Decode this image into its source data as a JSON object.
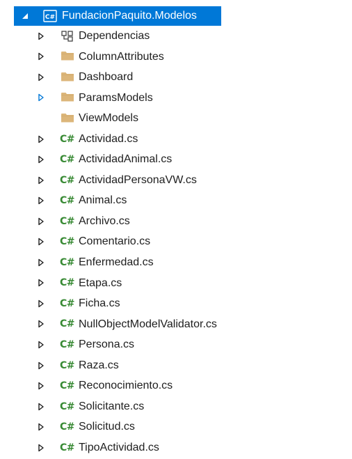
{
  "project": {
    "name": "FundacionPaquito.Modelos",
    "icon": "csharp-project-icon",
    "expanded": true
  },
  "items": [
    {
      "label": "Dependencias",
      "icon": "dependencies-icon",
      "expander": "collapsed"
    },
    {
      "label": "ColumnAttributes",
      "icon": "folder-icon",
      "expander": "collapsed"
    },
    {
      "label": "Dashboard",
      "icon": "folder-icon",
      "expander": "collapsed"
    },
    {
      "label": "ParamsModels",
      "icon": "folder-icon",
      "expander": "collapsed-highlight"
    },
    {
      "label": "ViewModels",
      "icon": "folder-icon",
      "expander": "none"
    },
    {
      "label": "Actividad.cs",
      "icon": "csharp-file-icon",
      "expander": "collapsed"
    },
    {
      "label": "ActividadAnimal.cs",
      "icon": "csharp-file-icon",
      "expander": "collapsed"
    },
    {
      "label": "ActividadPersonaVW.cs",
      "icon": "csharp-file-icon",
      "expander": "collapsed"
    },
    {
      "label": "Animal.cs",
      "icon": "csharp-file-icon",
      "expander": "collapsed"
    },
    {
      "label": "Archivo.cs",
      "icon": "csharp-file-icon",
      "expander": "collapsed"
    },
    {
      "label": "Comentario.cs",
      "icon": "csharp-file-icon",
      "expander": "collapsed"
    },
    {
      "label": "Enfermedad.cs",
      "icon": "csharp-file-icon",
      "expander": "collapsed"
    },
    {
      "label": "Etapa.cs",
      "icon": "csharp-file-icon",
      "expander": "collapsed"
    },
    {
      "label": "Ficha.cs",
      "icon": "csharp-file-icon",
      "expander": "collapsed"
    },
    {
      "label": "NullObjectModelValidator.cs",
      "icon": "csharp-file-icon",
      "expander": "collapsed"
    },
    {
      "label": "Persona.cs",
      "icon": "csharp-file-icon",
      "expander": "collapsed"
    },
    {
      "label": "Raza.cs",
      "icon": "csharp-file-icon",
      "expander": "collapsed"
    },
    {
      "label": "Reconocimiento.cs",
      "icon": "csharp-file-icon",
      "expander": "collapsed"
    },
    {
      "label": "Solicitante.cs",
      "icon": "csharp-file-icon",
      "expander": "collapsed"
    },
    {
      "label": "Solicitud.cs",
      "icon": "csharp-file-icon",
      "expander": "collapsed"
    },
    {
      "label": "TipoActividad.cs",
      "icon": "csharp-file-icon",
      "expander": "collapsed"
    }
  ],
  "colors": {
    "selection": "#0078d7",
    "folder": "#dcb67a",
    "csharp": "#388a34",
    "expander": "#1e1e1e",
    "expander_highlight": "#0078d7"
  }
}
